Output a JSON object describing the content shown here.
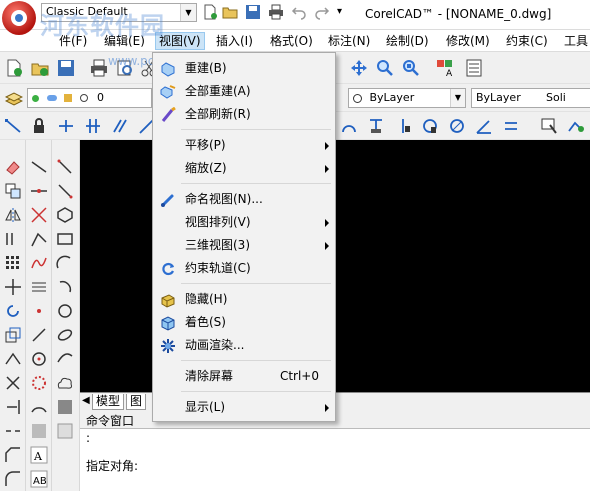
{
  "title_bar": {
    "workspace": "Classic Default",
    "title": "CorelCAD™ - [NONAME_0.dwg]",
    "watermark": "河东软件园",
    "watermark_url": "www.pc0359.cn"
  },
  "menubar": {
    "items": [
      "件(F)",
      "编辑(E)",
      "视图(V)",
      "插入(I)",
      "格式(O)",
      "标注(N)",
      "绘制(D)",
      "修改(M)",
      "约束(C)",
      "工具"
    ]
  },
  "layer_toolbar": {
    "layer_value": "0",
    "color_value": "ByLayer",
    "linetype_value": "ByLayer",
    "lineweight_value": "Soli"
  },
  "view_menu": {
    "items": [
      {
        "label": "重建(B)",
        "icon": "regen-icon"
      },
      {
        "label": "全部重建(A)",
        "icon": "regen-all-icon"
      },
      {
        "label": "全部刷新(R)",
        "icon": "redraw-all-icon"
      },
      {
        "label": "平移(P)",
        "submenu": true
      },
      {
        "label": "缩放(Z)",
        "submenu": true
      },
      {
        "label": "命名视图(N)...",
        "icon": "named-view-icon"
      },
      {
        "label": "视图排列(V)",
        "submenu": true
      },
      {
        "label": "三维视图(3)",
        "submenu": true
      },
      {
        "label": "约束轨道(C)",
        "icon": "orbit-icon"
      },
      {
        "label": "隐藏(H)",
        "icon": "hide-icon"
      },
      {
        "label": "着色(S)",
        "icon": "shade-icon"
      },
      {
        "label": "动画渲染...",
        "icon": "render-icon"
      },
      {
        "label": "清除屏幕",
        "shortcut": "Ctrl+0"
      },
      {
        "label": "显示(L)",
        "submenu": true
      }
    ]
  },
  "layout_tabs": {
    "model": "模型",
    "layout_fragment": "图"
  },
  "command_window": {
    "title": "命令窗口",
    "lines": [
      ":",
      "",
      "指定对角:"
    ]
  },
  "colors": {
    "accent_highlight": "#cce4f7",
    "canvas": "#000000",
    "menu_bg": "#f2f2f2"
  }
}
